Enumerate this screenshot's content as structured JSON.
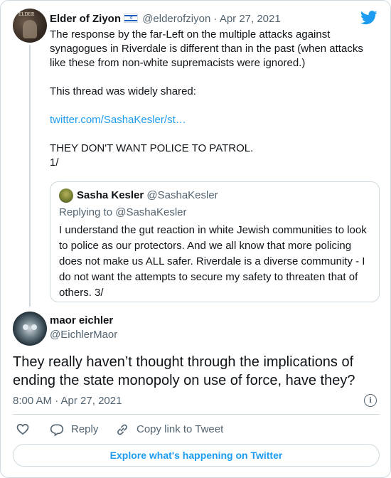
{
  "tweet": {
    "author_name": "Elder of Ziyon",
    "author_handle": "@elderofziyon",
    "date": "Apr 27, 2021",
    "paragraph1": "The response by the far-Left on the multiple attacks against synagogues in Riverdale is different than in the past (when attacks like these from non-white supremacists were ignored.)",
    "paragraph2": "This thread was widely shared:",
    "link": "twitter.com/SashaKesler/st…",
    "paragraph3_line1": "THEY DON'T WANT POLICE TO PATROL.",
    "paragraph3_line2": "1/"
  },
  "quoted": {
    "author_name": "Sasha Kesler",
    "author_handle": "@SashaKesler",
    "replying_label": "Replying to ",
    "replying_handle": "@SashaKesler",
    "text": "I understand the gut reaction in white Jewish communities to look to police as our protectors. And we all know that more policing does not make us ALL safer. Riverdale is a diverse community - I do not want the attempts to secure my safety to threaten that of others. 3/"
  },
  "reply": {
    "author_name": "maor eichler",
    "author_handle": "@EichlerMaor",
    "text": "They really haven’t thought through the implications of ending the state monopoly on use of force, have they?",
    "timestamp": "8:00 AM · Apr 27, 2021"
  },
  "actions": {
    "reply_label": "Reply",
    "copy_link_label": "Copy link to Tweet"
  },
  "footer": {
    "explore_label": "Explore what's happening on Twitter"
  },
  "icons": {
    "brand": "twitter-bird-icon",
    "like": "heart-icon",
    "reply": "speech-bubble-icon",
    "copy": "link-icon",
    "info": "info-icon",
    "flag": "israel-flag-icon"
  },
  "colors": {
    "accent": "#1d9bf0",
    "text": "#0f1419",
    "secondary": "#536471",
    "border": "#cfd9de"
  }
}
